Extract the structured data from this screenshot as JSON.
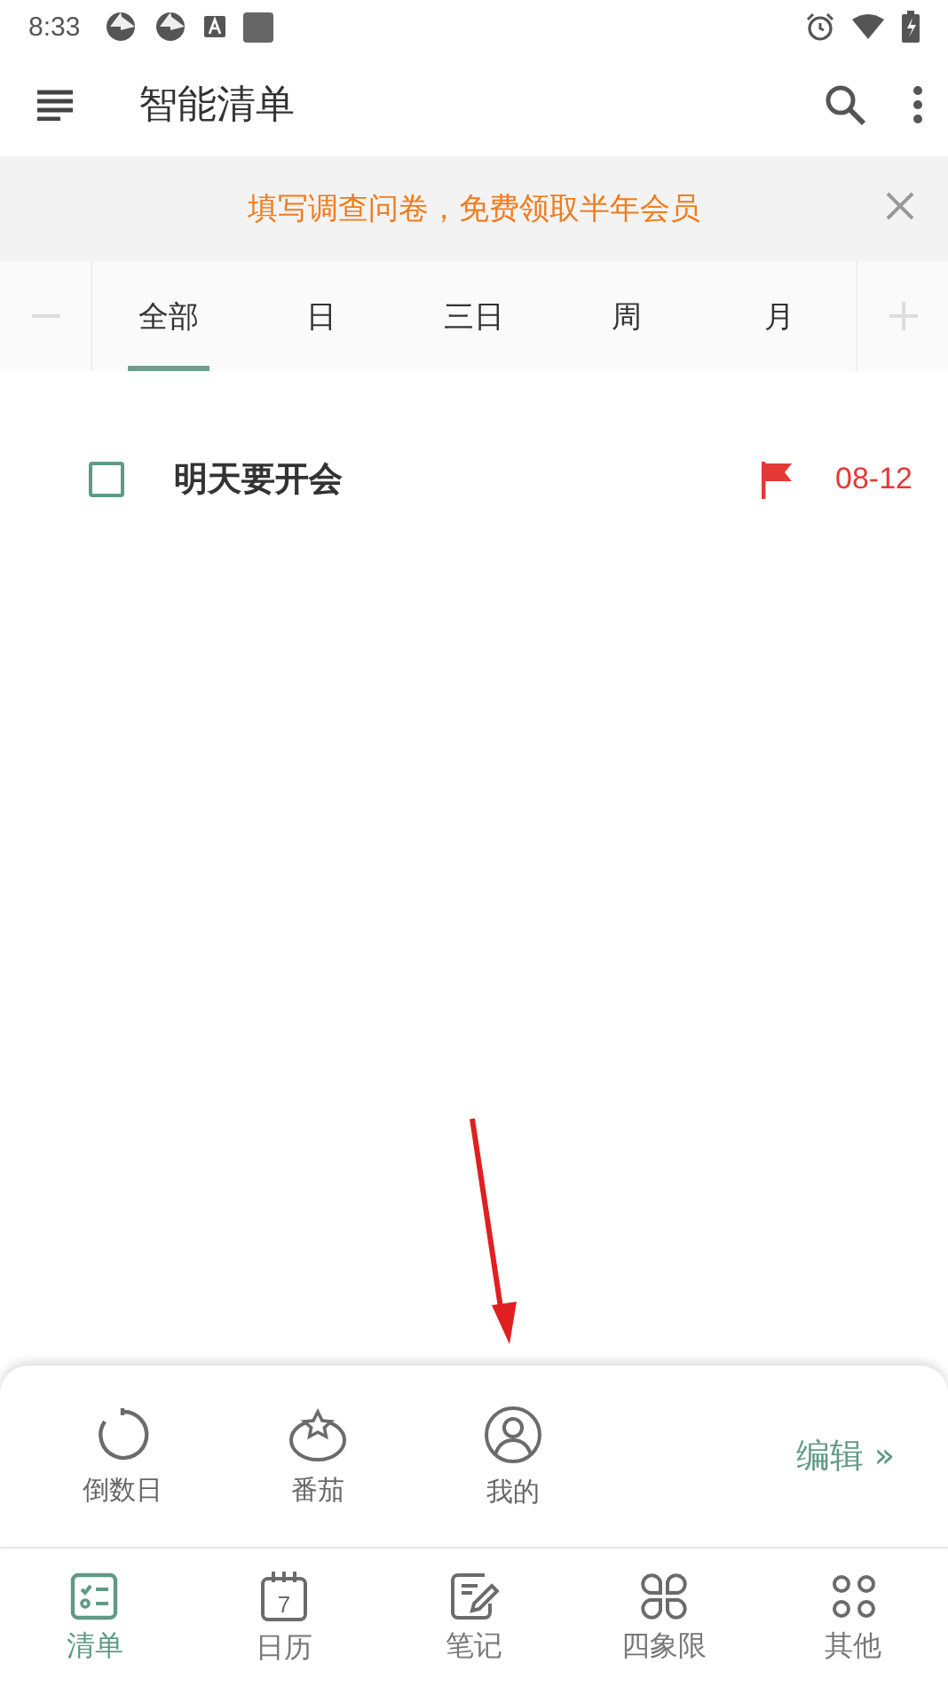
{
  "status_bar": {
    "time": "8:33"
  },
  "app_bar": {
    "title": "智能清单"
  },
  "banner": {
    "text": "填写调查问卷，免费领取半年会员"
  },
  "tabs": [
    {
      "label": "全部",
      "selected": true
    },
    {
      "label": "日",
      "selected": false
    },
    {
      "label": "三日",
      "selected": false
    },
    {
      "label": "周",
      "selected": false
    },
    {
      "label": "月",
      "selected": false
    }
  ],
  "tasks": [
    {
      "title": "明天要开会",
      "checked": false,
      "flagged": true,
      "date": "08-12"
    }
  ],
  "shortcuts": [
    {
      "kind": "countdown",
      "label": "倒数日"
    },
    {
      "kind": "tomato",
      "label": "番茄"
    },
    {
      "kind": "profile",
      "label": "我的"
    }
  ],
  "edit_link": {
    "label": "编辑",
    "arrow": "»"
  },
  "bottom_nav": [
    {
      "kind": "checklist",
      "label": "清单",
      "selected": true
    },
    {
      "kind": "calendar",
      "label": "日历",
      "day": "7",
      "selected": false
    },
    {
      "kind": "note",
      "label": "笔记",
      "selected": false
    },
    {
      "kind": "quadrant",
      "label": "四象限",
      "selected": false
    },
    {
      "kind": "more",
      "label": "其他",
      "selected": false
    }
  ]
}
